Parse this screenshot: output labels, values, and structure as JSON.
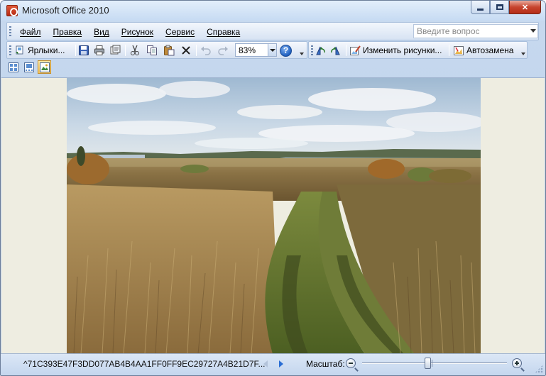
{
  "window": {
    "title": "Microsoft Office 2010",
    "controls": {
      "minimize": "minimize",
      "maximize": "maximize",
      "close": "✕"
    }
  },
  "menu": {
    "items": [
      "Файл",
      "Правка",
      "Вид",
      "Рисунок",
      "Сервис",
      "Справка"
    ],
    "ask_placeholder": "Введите вопрос"
  },
  "toolbar": {
    "shortcuts_label": "Ярлыки...",
    "zoom_value": "83%",
    "help_glyph": "?",
    "edit_picture_label": "Изменить рисунки...",
    "autocorrect_label": "Автозамена",
    "icons": [
      "shortcuts-icon",
      "save-icon",
      "print-icon",
      "send-icon",
      "cut-icon",
      "copy-icon",
      "paste-icon",
      "delete-icon",
      "undo-icon",
      "redo-icon",
      "help-icon",
      "rotate-left-icon",
      "rotate-right-icon",
      "edit-picture-icon",
      "autocorrect-icon"
    ]
  },
  "view_modes": [
    {
      "name": "thumbnails",
      "active": false
    },
    {
      "name": "filmstrip",
      "active": false
    },
    {
      "name": "single-picture",
      "active": true
    }
  ],
  "status": {
    "filename": "^71C393E47F3DD077AB4B4AA1FF0FF9EC29727A4B21D7F...",
    "scale_label": "Масштаб:",
    "zoom_level": 0.45
  },
  "colors": {
    "accent": "#2a6ed4",
    "active_view": "#f7c45a",
    "close_button": "#c7442e"
  }
}
